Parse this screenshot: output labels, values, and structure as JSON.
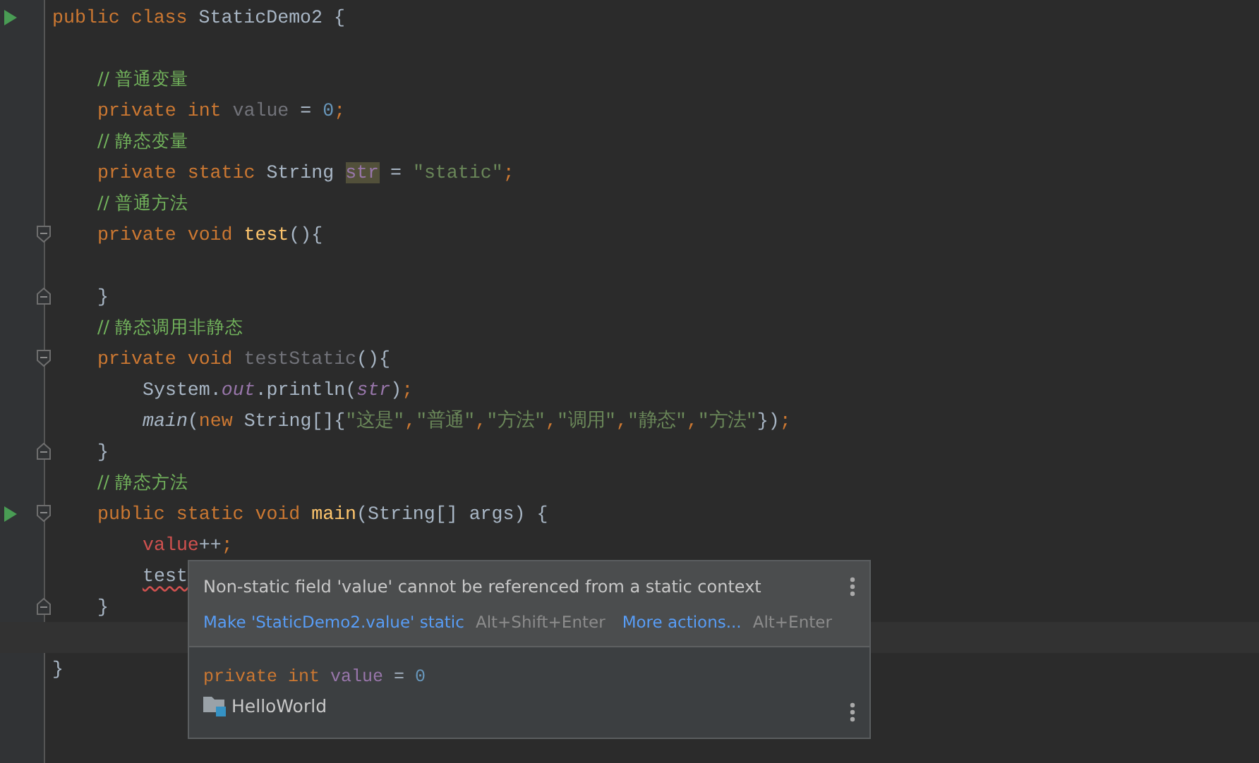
{
  "editor": {
    "lines": [
      {
        "kind": "code",
        "run": true,
        "tokens": [
          {
            "kind": "kw",
            "text": "public class "
          },
          {
            "kind": "plain",
            "text": "StaticDemo2 {"
          }
        ],
        "children": [
          {
            "kind": "blank"
          },
          {
            "kind": "code",
            "tokens": [
              {
                "kind": "comment",
                "text": "// 普通变量"
              }
            ]
          },
          {
            "kind": "code",
            "tokens": [
              {
                "kind": "kw",
                "text": "private int "
              },
              {
                "kind": "unused",
                "text": "value"
              },
              {
                "kind": "plain",
                "text": " = "
              },
              {
                "kind": "num",
                "text": "0"
              },
              {
                "kind": "kw",
                "text": ";"
              }
            ]
          },
          {
            "kind": "code",
            "tokens": [
              {
                "kind": "comment",
                "text": "// 静态变量"
              }
            ]
          },
          {
            "kind": "code",
            "tokens": [
              {
                "kind": "kw",
                "text": "private static "
              },
              {
                "kind": "plain",
                "text": "String "
              },
              {
                "kind": "field_hl",
                "text": "str"
              },
              {
                "kind": "plain",
                "text": " = "
              },
              {
                "kind": "str",
                "text": "\"static\""
              },
              {
                "kind": "kw",
                "text": ";"
              }
            ]
          },
          {
            "kind": "code",
            "tokens": [
              {
                "kind": "comment",
                "text": "// 普通方法"
              }
            ]
          },
          {
            "kind": "code",
            "fold_start": true,
            "tokens": [
              {
                "kind": "kw",
                "text": "private void "
              },
              {
                "kind": "method",
                "text": "test"
              },
              {
                "kind": "plain",
                "text": "(){"
              }
            ],
            "children": [
              {
                "kind": "blank"
              }
            ]
          },
          {
            "kind": "code",
            "fold_end": true,
            "tokens": [
              {
                "kind": "plain",
                "text": "}"
              }
            ]
          },
          {
            "kind": "code",
            "tokens": [
              {
                "kind": "comment",
                "text": "// 静态调用非静态"
              }
            ]
          },
          {
            "kind": "code",
            "fold_start": true,
            "tokens": [
              {
                "kind": "kw",
                "text": "private void "
              },
              {
                "kind": "unused",
                "text": "testStatic"
              },
              {
                "kind": "plain",
                "text": "(){"
              }
            ],
            "children": [
              {
                "kind": "code",
                "tokens": [
                  {
                    "kind": "plain",
                    "text": "System."
                  },
                  {
                    "kind": "static_field",
                    "text": "out"
                  },
                  {
                    "kind": "plain",
                    "text": ".println("
                  },
                  {
                    "kind": "static_field",
                    "text": "str"
                  },
                  {
                    "kind": "plain",
                    "text": ")"
                  },
                  {
                    "kind": "kw",
                    "text": ";"
                  }
                ]
              },
              {
                "kind": "code",
                "tokens": [
                  {
                    "kind": "static_call",
                    "text": "main"
                  },
                  {
                    "kind": "plain",
                    "text": "("
                  },
                  {
                    "kind": "kw",
                    "text": "new "
                  },
                  {
                    "kind": "plain",
                    "text": "String[]{"
                  },
                  {
                    "kind": "str",
                    "text": "\"这是\""
                  },
                  {
                    "kind": "kw",
                    "text": ","
                  },
                  {
                    "kind": "str",
                    "text": "\"普通\""
                  },
                  {
                    "kind": "kw",
                    "text": ","
                  },
                  {
                    "kind": "str",
                    "text": "\"方法\""
                  },
                  {
                    "kind": "kw",
                    "text": ","
                  },
                  {
                    "kind": "str",
                    "text": "\"调用\""
                  },
                  {
                    "kind": "kw",
                    "text": ","
                  },
                  {
                    "kind": "str",
                    "text": "\"静态\""
                  },
                  {
                    "kind": "kw",
                    "text": ","
                  },
                  {
                    "kind": "str",
                    "text": "\"方法\""
                  },
                  {
                    "kind": "plain",
                    "text": "})"
                  },
                  {
                    "kind": "kw",
                    "text": ";"
                  }
                ]
              }
            ]
          },
          {
            "kind": "code",
            "fold_end": true,
            "tokens": [
              {
                "kind": "plain",
                "text": "}"
              }
            ]
          },
          {
            "kind": "code",
            "tokens": [
              {
                "kind": "comment",
                "text": "// 静态方法"
              }
            ]
          },
          {
            "kind": "code",
            "run": true,
            "fold_start": true,
            "tokens": [
              {
                "kind": "kw",
                "text": "public static void "
              },
              {
                "kind": "method",
                "text": "main"
              },
              {
                "kind": "plain",
                "text": "(String[] args) {"
              }
            ],
            "children": [
              {
                "kind": "code",
                "tokens": [
                  {
                    "kind": "error",
                    "text": "value"
                  },
                  {
                    "kind": "plain",
                    "text": "++"
                  },
                  {
                    "kind": "kw",
                    "text": ";"
                  }
                ]
              },
              {
                "kind": "code",
                "tokens": [
                  {
                    "kind": "squiggle",
                    "text": "test"
                  }
                ]
              }
            ]
          },
          {
            "kind": "code",
            "fold_end": true,
            "tokens": [
              {
                "kind": "plain",
                "text": "}"
              }
            ]
          },
          {
            "kind": "blank",
            "current": true
          }
        ]
      },
      {
        "kind": "code",
        "tokens": [
          {
            "kind": "plain",
            "text": "}"
          }
        ]
      }
    ]
  },
  "popup": {
    "message": "Non-static field 'value' cannot be referenced from a static context",
    "actions": [
      {
        "label": "Make 'StaticDemo2.value' static",
        "shortcut": "Alt+Shift+Enter"
      },
      {
        "label": "More actions...",
        "shortcut": "Alt+Enter"
      }
    ],
    "declaration": [
      {
        "kind": "kw",
        "text": "private int "
      },
      {
        "kind": "field",
        "text": "value"
      },
      {
        "kind": "plain",
        "text": " = "
      },
      {
        "kind": "num",
        "text": "0"
      }
    ],
    "location": "HelloWorld"
  }
}
